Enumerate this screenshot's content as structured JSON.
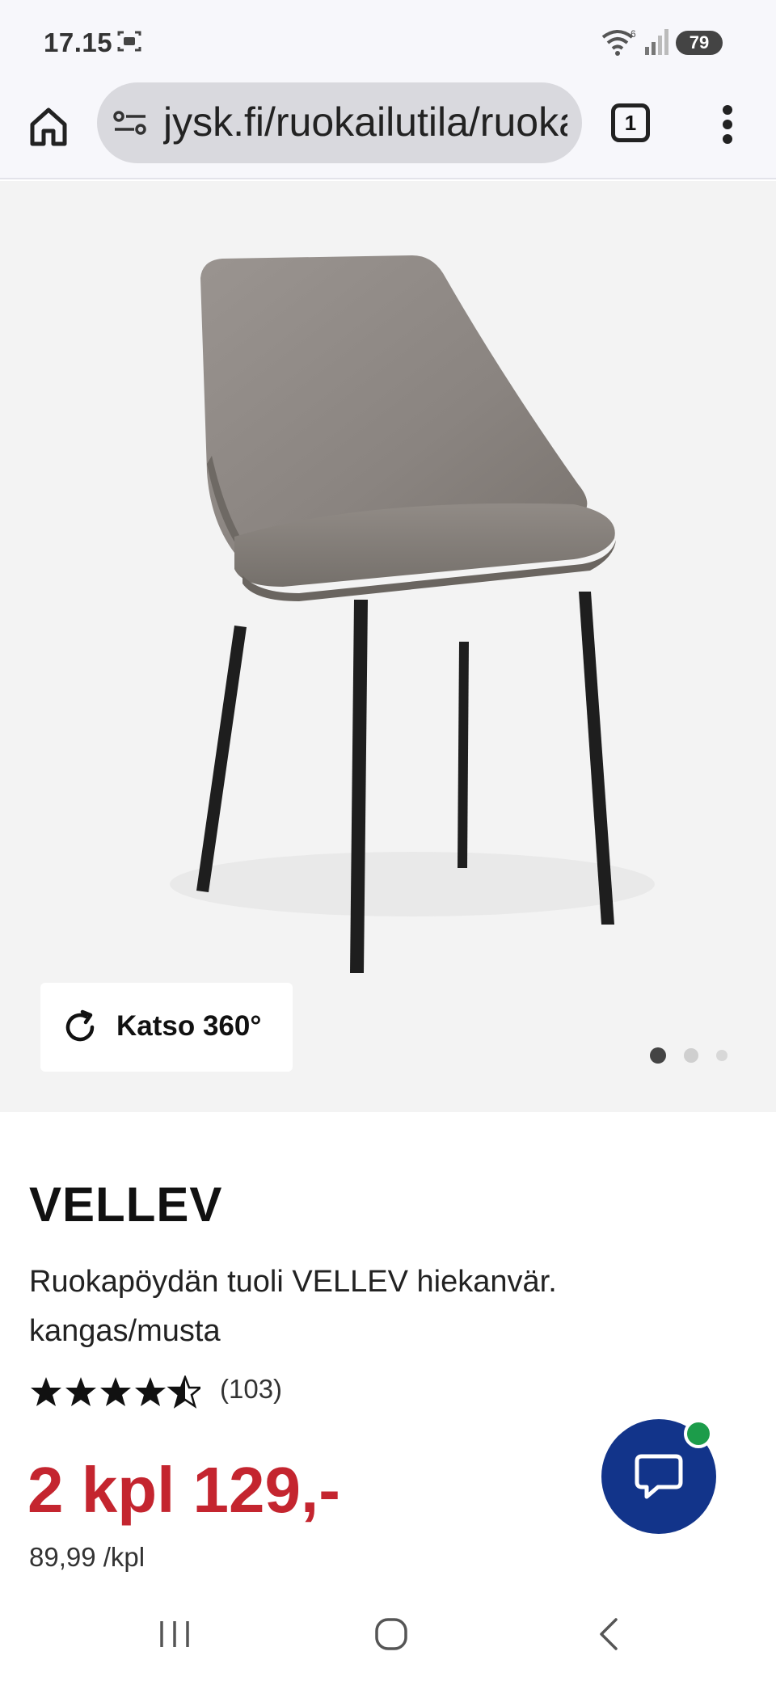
{
  "status_bar": {
    "time": "17.15",
    "battery": "79"
  },
  "browser": {
    "url": "jysk.fi/ruokailutila/ruokapoydan-tuolit",
    "tab_count": "1"
  },
  "gallery": {
    "view360_label": "Katso 360°",
    "dot_count": 3,
    "active_dot": 0
  },
  "product": {
    "name": "VELLEV",
    "description": "Ruokapöydän tuoli VELLEV hiekanvär. kangas/musta",
    "rating_value": 4.5,
    "rating_count": "(103)",
    "price": "2 kpl 129,-",
    "unit_price": "89,99 /kpl"
  },
  "colors": {
    "price_red": "#c4252f",
    "chat_blue": "#12348a",
    "online_green": "#1c9c4a"
  }
}
